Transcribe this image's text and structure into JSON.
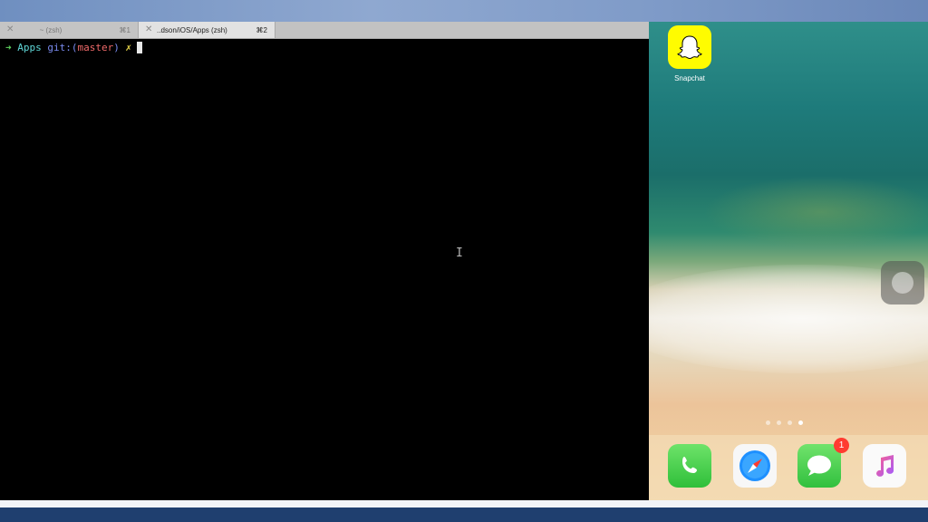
{
  "terminal": {
    "tabs": [
      {
        "close": "✕",
        "title": "~ (zsh)",
        "shortcut": "⌘1",
        "active": false
      },
      {
        "close": "✕",
        "title": "..dson/iOS/Apps (zsh)",
        "shortcut": "⌘2",
        "active": true
      }
    ],
    "prompt": {
      "arrow": "➜",
      "dir": "Apps",
      "git_prefix": "git:(",
      "branch": "master",
      "git_suffix": ")",
      "dirty": "✗"
    },
    "mouse_cursor_glyph": "I"
  },
  "simulator": {
    "apps": [
      {
        "label": "Snapchat",
        "icon": "snapchat-ghost-icon"
      }
    ],
    "page_dots": 4,
    "active_page": 4,
    "dock": [
      {
        "icon": "phone-icon"
      },
      {
        "icon": "safari-compass-icon"
      },
      {
        "icon": "messages-bubble-icon",
        "badge": "1"
      },
      {
        "icon": "music-note-icon"
      }
    ]
  },
  "colors": {
    "prompt_arrow": "#5fd35f",
    "prompt_dir": "#5fd7d7",
    "prompt_git": "#7b8cf0",
    "prompt_branch": "#f06a6a",
    "prompt_dirty": "#e6d54a",
    "snapchat_yellow": "#fffc00",
    "badge_red": "#ff3b30"
  }
}
